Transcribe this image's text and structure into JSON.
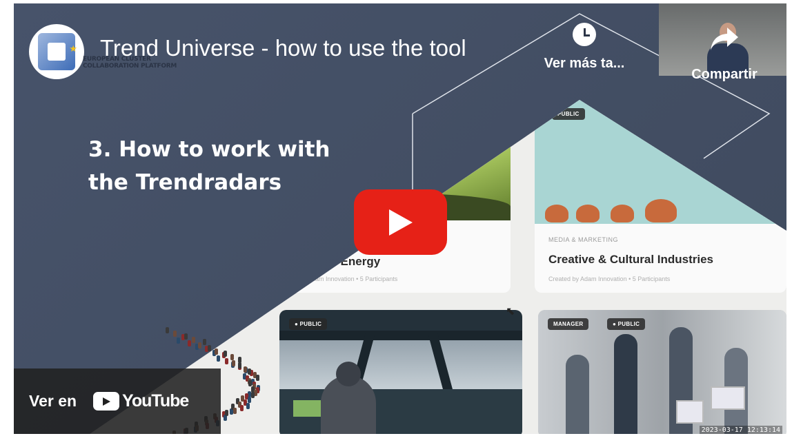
{
  "video": {
    "title": "Trend Universe - how to use the tool",
    "heading_line1": "3. How to work with",
    "heading_line2": "the Trendradars"
  },
  "logo": {
    "line1": "EUROPEAN CLUSTER",
    "line2": "COLLABORATION PLATFORM"
  },
  "actions": {
    "watch_later": "Ver más ta...",
    "share": "Compartir"
  },
  "watch_on": {
    "prefix": "Ver en",
    "brand": "YouTube"
  },
  "cards": [
    {
      "badge": "",
      "category": "",
      "title": "Renewable Energy",
      "subtitle": "Created by Adam Innovation • 5 Participants"
    },
    {
      "badge": "PUBLIC",
      "category": "MEDIA & MARKETING",
      "title": "Creative & Cultural Industries",
      "subtitle": "Created by Adam Innovation • 5 Participants"
    },
    {
      "badge": "● PUBLIC",
      "category": "",
      "title": "",
      "subtitle": ""
    },
    {
      "badge1": "MANAGER",
      "badge2": "● PUBLIC",
      "timestamp": "2023-03-17 12:13:14"
    }
  ],
  "colors": {
    "background": "#465266",
    "play_button": "#e62117",
    "title_text": "#ffffff"
  },
  "icons": [
    "clock-icon",
    "share-arrow-icon",
    "play-icon",
    "youtube-logo-icon"
  ]
}
